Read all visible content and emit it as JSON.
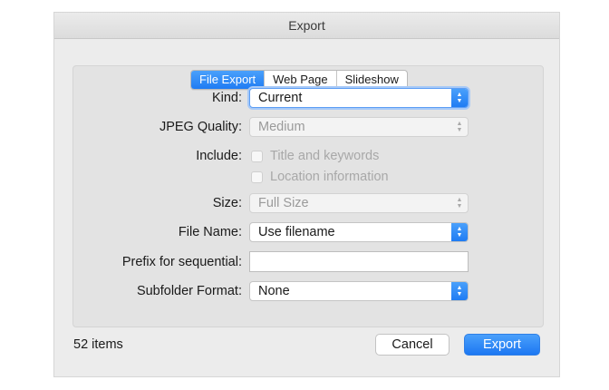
{
  "window": {
    "title": "Export"
  },
  "tabs": [
    {
      "label": "File Export",
      "active": true
    },
    {
      "label": "Web Page",
      "active": false
    },
    {
      "label": "Slideshow",
      "active": false
    }
  ],
  "form": {
    "kind": {
      "label": "Kind:",
      "value": "Current"
    },
    "jpeg_quality": {
      "label": "JPEG Quality:",
      "value": "Medium"
    },
    "include": {
      "label": "Include:",
      "options": [
        {
          "label": "Title and keywords",
          "checked": false
        },
        {
          "label": "Location information",
          "checked": false
        }
      ]
    },
    "size": {
      "label": "Size:",
      "value": "Full Size"
    },
    "file_name": {
      "label": "File Name:",
      "value": "Use filename"
    },
    "prefix": {
      "label": "Prefix for sequential:",
      "value": ""
    },
    "subfolder_format": {
      "label": "Subfolder Format:",
      "value": "None"
    }
  },
  "footer": {
    "item_count": "52 items",
    "cancel_label": "Cancel",
    "export_label": "Export"
  },
  "colors": {
    "accent": "#1f7cf3",
    "dialog_bg": "#ececec"
  },
  "icons": {
    "popup_arrows": "up-down-chevron-icon"
  }
}
